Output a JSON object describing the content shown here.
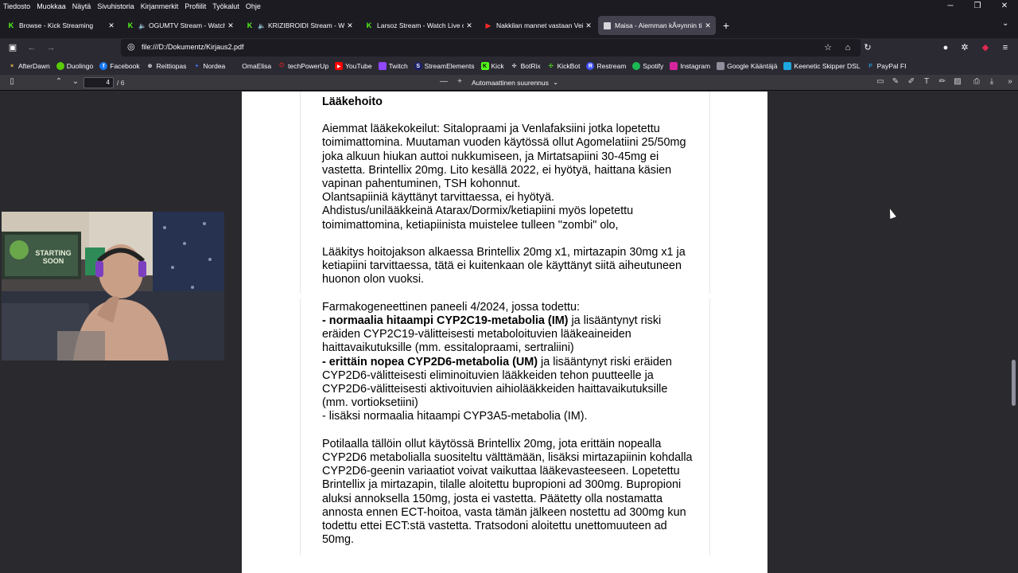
{
  "menu": [
    "Tiedosto",
    "Muokkaa",
    "Näytä",
    "Sivuhistoria",
    "Kirjanmerkit",
    "Profiilit",
    "Työkalut",
    "Ohje"
  ],
  "tabs": [
    {
      "title": "Browse - Kick Streaming",
      "icon": "kick-icon"
    },
    {
      "title": "OGUMTV Stream - Watch L",
      "icon": "kick-icon"
    },
    {
      "title": "KRIZIBROIDI Stream - Watc",
      "icon": "kick-icon"
    },
    {
      "title": "Larsoz Stream - Watch Live on K",
      "icon": "kick-icon"
    },
    {
      "title": "Nakkilan mannet vastaan Veikk",
      "icon": "youtube-icon"
    },
    {
      "title": "Maisa - Aiemman kÃ¤ynnin tied",
      "icon": "maisa-icon"
    }
  ],
  "url": "file:///D:/Dokumentz/Kirjaus2.pdf",
  "bookmarks": [
    "AfterDawn",
    "Duolingo",
    "Facebook",
    "Reittiopas",
    "Nordea",
    "OmaElisa",
    "techPowerUp",
    "YouTube",
    "Twitch",
    "StreamElements",
    "Kick",
    "BotRix",
    "KickBot",
    "Restream",
    "Spotify",
    "Instagram",
    "Google Kääntäjä",
    "Keenetic Skipper DSL",
    "PayPal FI"
  ],
  "pdf": {
    "page_current": "4",
    "page_total": "/ 6",
    "zoom": "Automaattinen suurennus"
  },
  "webcam": {
    "sign_text": "STARTING SOON"
  },
  "document": {
    "heading": "Lääkehoito",
    "p1_l1": "Aiemmat lääkekokeilut: Sitalopraami ja Venlafaksiini jotka lopetettu",
    "p1_l2": "toimimattomina. Muutaman vuoden käytössä ollut Agomelatiini 25/50mg",
    "p1_l3": "joka alkuun hiukan auttoi nukkumiseen, ja Mirtatsapiini 30-45mg ei",
    "p1_l4": "vastetta. Brintellix 20mg. Lito kesällä 2022, ei hyötyä, haittana käsien",
    "p1_l5": "vapinan pahentuminen, TSH kohonnut.",
    "p1_l6": "Olantsapiiniä käyttänyt tarvittaessa, ei hyötyä.",
    "p1_l7": "Ahdistus/unilääkkeinä Atarax/Dormix/ketiapiini myös lopetettu",
    "p1_l8": "toimimattomina, ketiapiinista muistelee tulleen \"zombi\" olo,",
    "p2_l1": "Lääkitys hoitojakson alkaessa Brintellix 20mg x1, mirtazapin 30mg x1 ja",
    "p2_l2": "ketiapiini tarvittaessa, tätä ei kuitenkaan ole käyttänyt siitä aiheutuneen",
    "p2_l3": "huonon olon vuoksi.",
    "p3_l1": "Farmakogeneettinen paneeli 4/2024, jossa todettu:",
    "p3_l2_bold": "- normaalia hitaampi CYP2C19-metabolia (IM)",
    "p3_l2_rest": " ja lisääntynyt riski",
    "p3_l3": "eräiden CYP2C19-välitteisesti metaboloituvien lääkeaineiden",
    "p3_l4": "haittavaikutuksille (mm. essitalopraami, sertraliini)",
    "p3_l5_bold": "- erittäin nopea CYP2D6-metabolia (UM)",
    "p3_l5_rest": " ja lisääntynyt riski eräiden",
    "p3_l6": "CYP2D6-välitteisesti eliminoituvien lääkkeiden tehon puutteelle ja",
    "p3_l7": "CYP2D6-välitteisesti aktivoituvien aihiolääkkeiden haittavaikutuksille",
    "p3_l8": "(mm. vortioksetiini)",
    "p3_l9": "- lisäksi normaalia hitaampi CYP3A5-metabolia (IM).",
    "p4_l1": "Potilaalla tällöin ollut käytössä Brintellix 20mg, jota erittäin nopealla",
    "p4_l2": "CYP2D6 metabolialla suositeltu välttämään, lisäksi mirtazapiinin kohdalla",
    "p4_l3": "CYP2D6-geenin variaatiot voivat vaikuttaa lääkevasteeseen. Lopetettu",
    "p4_l4": "Brintellix ja mirtazapin, tilalle aloitettu bupropioni ad 300mg. Bupropioni",
    "p4_l5": "aluksi annoksella 150mg, josta ei vastetta. Päätetty olla nostamatta",
    "p4_l6": "annosta ennen ECT-hoitoa, vasta tämän jälkeen nostettu ad 300mg kun",
    "p4_l7": "todettu ettei ECT:stä vastetta. Tratsodoni aloitettu unettomuuteen ad",
    "p4_l8": "50mg."
  },
  "colors": {
    "kick": "#53fc18",
    "youtube": "#ff2a2a",
    "chrome_dark": "#1c1b22",
    "chrome": "#2b2a33",
    "viewer_bg": "#2a2a2e"
  }
}
